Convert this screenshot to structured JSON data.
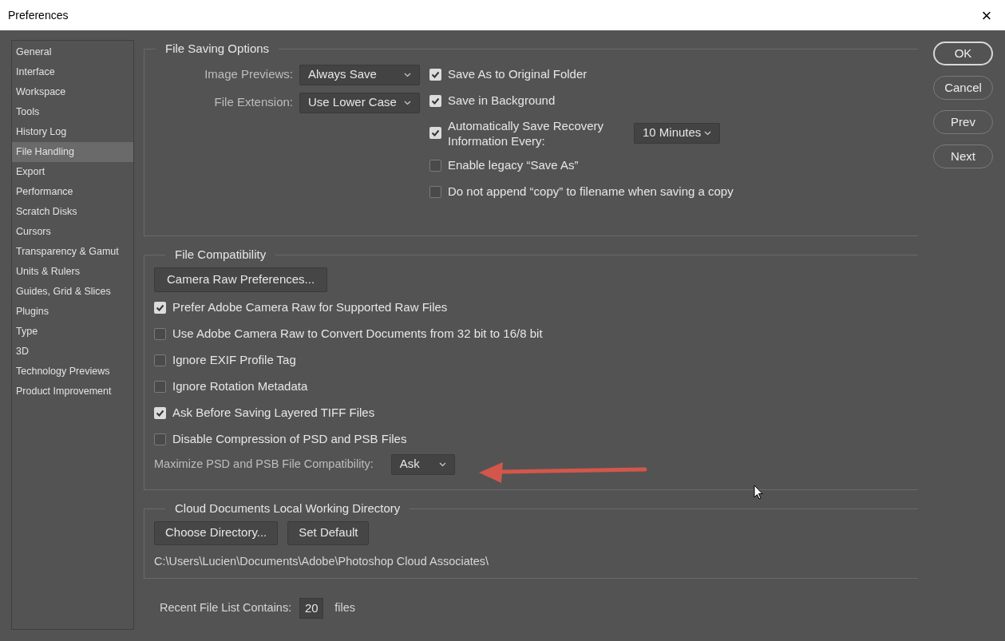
{
  "window": {
    "title": "Preferences",
    "close": "×"
  },
  "sidebar": {
    "items": [
      {
        "label": "General",
        "selected": false
      },
      {
        "label": "Interface",
        "selected": false
      },
      {
        "label": "Workspace",
        "selected": false
      },
      {
        "label": "Tools",
        "selected": false
      },
      {
        "label": "History Log",
        "selected": false
      },
      {
        "label": "File Handling",
        "selected": true
      },
      {
        "label": "Export",
        "selected": false
      },
      {
        "label": "Performance",
        "selected": false
      },
      {
        "label": "Scratch Disks",
        "selected": false
      },
      {
        "label": "Cursors",
        "selected": false
      },
      {
        "label": "Transparency & Gamut",
        "selected": false
      },
      {
        "label": "Units & Rulers",
        "selected": false
      },
      {
        "label": "Guides, Grid & Slices",
        "selected": false
      },
      {
        "label": "Plugins",
        "selected": false
      },
      {
        "label": "Type",
        "selected": false
      },
      {
        "label": "3D",
        "selected": false
      },
      {
        "label": "Technology Previews",
        "selected": false
      },
      {
        "label": "Product Improvement",
        "selected": false
      }
    ]
  },
  "file_saving_options": {
    "title": "File Saving Options",
    "dropdowns": [
      {
        "label": "Image Previews:",
        "value": "Always Save"
      },
      {
        "label": "File Extension:",
        "value": "Use Lower Case"
      }
    ],
    "checkboxes": [
      {
        "label": "Save As to Original Folder",
        "checked": true
      },
      {
        "label": "Save in Background",
        "checked": true
      },
      {
        "label": "Automatically Save Recovery Information Every:",
        "checked": true,
        "dropdown": "10 Minutes"
      },
      {
        "label": "Enable legacy “Save As”",
        "checked": false
      },
      {
        "label": "Do not append “copy” to filename when saving a copy",
        "checked": false
      }
    ]
  },
  "file_compatibility": {
    "title": "File Compatibility",
    "button": "Camera Raw Preferences...",
    "checkboxes": [
      {
        "label": "Prefer Adobe Camera Raw for Supported Raw Files",
        "checked": true
      },
      {
        "label": "Use Adobe Camera Raw to Convert Documents from 32 bit to 16/8 bit",
        "checked": false
      },
      {
        "label": "Ignore EXIF Profile Tag",
        "checked": false
      },
      {
        "label": "Ignore Rotation Metadata",
        "checked": false
      },
      {
        "label": "Ask Before Saving Layered TIFF Files",
        "checked": true
      },
      {
        "label": "Disable Compression of PSD and PSB Files",
        "checked": false
      }
    ],
    "maximize": {
      "label": "Maximize PSD and PSB File Compatibility:",
      "value": "Ask"
    }
  },
  "cloud_documents": {
    "title": "Cloud Documents Local Working Directory",
    "buttons": [
      "Choose Directory...",
      "Set Default"
    ],
    "path": "C:\\Users\\Lucien\\Documents\\Adobe\\Photoshop Cloud Associates\\"
  },
  "recent_files": {
    "label": "Recent File List Contains:",
    "value": "20",
    "unit": "files"
  },
  "buttons": [
    {
      "label": "OK",
      "default": true
    },
    {
      "label": "Cancel",
      "default": false
    },
    {
      "label": "Prev",
      "default": false
    },
    {
      "label": "Next",
      "default": false
    }
  ]
}
